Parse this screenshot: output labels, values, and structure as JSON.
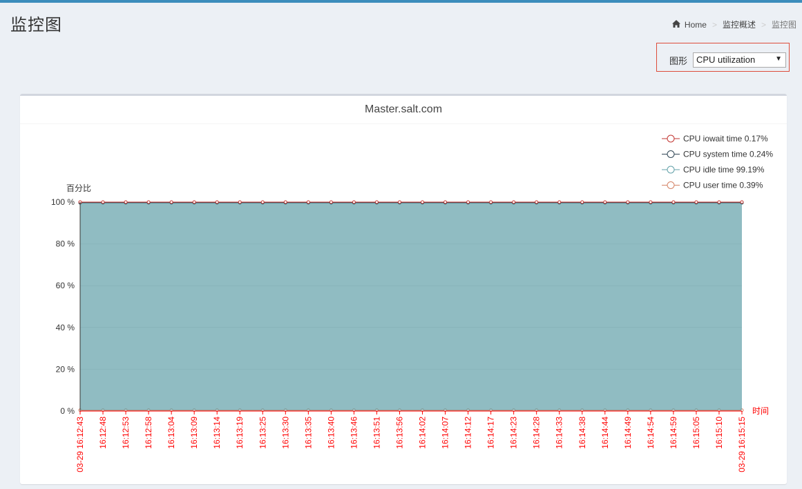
{
  "page": {
    "title": "监控图",
    "breadcrumb": {
      "home": "Home",
      "parent": "监控概述",
      "current": "监控图"
    }
  },
  "filter": {
    "label": "图形",
    "selected": "CPU utilization"
  },
  "colors": {
    "accent": "#3c8dbc",
    "iowait": "#c23531",
    "system": "#2f4554",
    "idle": "#61a0a8",
    "user": "#d48265",
    "axis_label": "#ff0000"
  },
  "chart_data": {
    "type": "area",
    "title": "Master.salt.com",
    "ylabel": "百分比",
    "xlabel": "时间",
    "ylim": [
      0,
      100
    ],
    "yticks": [
      "0 %",
      "20 %",
      "40 %",
      "60 %",
      "80 %",
      "100 %"
    ],
    "legend_position": "top-right",
    "legend": [
      "CPU iowait time 0.17%",
      "CPU system time 0.24%",
      "CPU idle time 99.19%",
      "CPU user time 0.39%"
    ],
    "x": [
      "03-29 16:12:43",
      "16:12:48",
      "16:12:53",
      "16:12:58",
      "16:13:04",
      "16:13:09",
      "16:13:14",
      "16:13:19",
      "16:13:25",
      "16:13:30",
      "16:13:35",
      "16:13:40",
      "16:13:46",
      "16:13:51",
      "16:13:56",
      "16:14:02",
      "16:14:07",
      "16:14:12",
      "16:14:17",
      "16:14:23",
      "16:14:28",
      "16:14:33",
      "16:14:38",
      "16:14:44",
      "16:14:49",
      "16:14:54",
      "16:14:59",
      "16:15:05",
      "16:15:10",
      "03-29 16:15:15"
    ],
    "series": [
      {
        "name": "CPU user time",
        "values": [
          0.4,
          0.4,
          0.4,
          0.4,
          0.4,
          0.4,
          0.4,
          0.4,
          0.4,
          0.4,
          0.4,
          0.4,
          0.4,
          0.4,
          0.4,
          0.4,
          0.4,
          0.4,
          0.4,
          0.4,
          0.4,
          0.4,
          0.4,
          0.4,
          0.4,
          0.4,
          0.4,
          0.4,
          0.4,
          0.4
        ]
      },
      {
        "name": "CPU idle time",
        "values": [
          99.2,
          99.2,
          99.2,
          99.2,
          99.2,
          99.2,
          99.2,
          99.2,
          99.2,
          99.2,
          99.2,
          99.2,
          99.2,
          99.2,
          99.2,
          99.2,
          99.2,
          99.2,
          99.2,
          99.2,
          99.2,
          99.2,
          99.2,
          99.2,
          99.2,
          99.2,
          99.2,
          99.2,
          99.2,
          99.2
        ]
      },
      {
        "name": "CPU system time",
        "values": [
          0.2,
          0.2,
          0.2,
          0.2,
          0.2,
          0.2,
          0.2,
          0.2,
          0.2,
          0.2,
          0.2,
          0.2,
          0.2,
          0.2,
          0.2,
          0.2,
          0.2,
          0.2,
          0.2,
          0.2,
          0.2,
          0.2,
          0.2,
          0.2,
          0.2,
          0.2,
          0.2,
          0.2,
          0.2,
          0.2
        ]
      },
      {
        "name": "CPU iowait time",
        "values": [
          0.2,
          0.2,
          0.2,
          0.2,
          0.2,
          0.2,
          0.2,
          0.2,
          0.2,
          0.2,
          0.2,
          0.2,
          0.2,
          0.2,
          0.2,
          0.2,
          0.2,
          0.2,
          0.2,
          0.2,
          0.2,
          0.2,
          0.2,
          0.2,
          0.2,
          0.2,
          0.2,
          0.2,
          0.2,
          0.2
        ]
      }
    ]
  }
}
